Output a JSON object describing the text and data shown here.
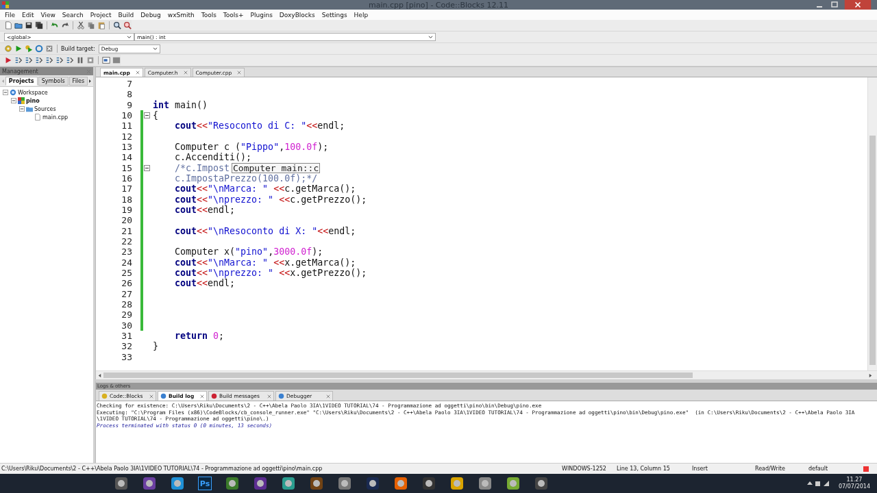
{
  "window": {
    "title": "main.cpp [pino] - Code::Blocks 12.11"
  },
  "menu": [
    "File",
    "Edit",
    "View",
    "Search",
    "Project",
    "Build",
    "Debug",
    "wxSmith",
    "Tools",
    "Tools+",
    "Plugins",
    "DoxyBlocks",
    "Settings",
    "Help"
  ],
  "scope_bar": {
    "scope": "<global>",
    "function": "main() : int"
  },
  "build_target": {
    "label": "Build target:",
    "value": "Debug"
  },
  "management": {
    "title": "Management",
    "tabs": [
      {
        "label": "Projects",
        "selected": true
      },
      {
        "label": "Symbols",
        "selected": false
      },
      {
        "label": "Files",
        "selected": false
      }
    ],
    "tree": [
      {
        "label": "Workspace",
        "kind": "workspace",
        "expanded": true,
        "children": [
          {
            "label": "pino",
            "kind": "project",
            "expanded": true,
            "children": [
              {
                "label": "Sources",
                "kind": "folder",
                "expanded": true,
                "children": [
                  {
                    "label": "main.cpp",
                    "kind": "file"
                  }
                ]
              }
            ]
          }
        ]
      }
    ]
  },
  "editor": {
    "tabs": [
      {
        "label": "main.cpp",
        "selected": true
      },
      {
        "label": "Computer.h",
        "selected": false
      },
      {
        "label": "Computer.cpp",
        "selected": false
      }
    ],
    "lines": [
      {
        "number": "7",
        "fold": false,
        "modified": false
      },
      {
        "number": "8",
        "fold": false,
        "modified": false
      },
      {
        "number": "9",
        "fold": false,
        "modified": false,
        "tokens": [
          {
            "kind": "keyword",
            "text": "int"
          },
          {
            "kind": "plain",
            "text": " main()"
          }
        ]
      },
      {
        "number": "10",
        "fold": true,
        "modified": true,
        "tokens": [
          {
            "kind": "plain",
            "text": "{"
          }
        ]
      },
      {
        "number": "11",
        "fold": false,
        "modified": true,
        "tokens": [
          {
            "kind": "keyword",
            "text": "    cout"
          },
          {
            "kind": "operator",
            "text": "<<"
          },
          {
            "kind": "string",
            "text": "\"Resoconto di C: \""
          },
          {
            "kind": "operator",
            "text": "<<"
          },
          {
            "kind": "plain",
            "text": "endl;"
          }
        ]
      },
      {
        "number": "12",
        "fold": false,
        "modified": true
      },
      {
        "number": "13",
        "fold": false,
        "modified": true,
        "tokens": [
          {
            "kind": "plain",
            "text": "    Computer c ("
          },
          {
            "kind": "string",
            "text": "\"Pippo\""
          },
          {
            "kind": "plain",
            "text": ","
          },
          {
            "kind": "number",
            "text": "100.0f"
          },
          {
            "kind": "plain",
            "text": ");"
          }
        ]
      },
      {
        "number": "14",
        "fold": false,
        "modified": true,
        "tokens": [
          {
            "kind": "plain",
            "text": "    c.Accenditi();"
          }
        ]
      },
      {
        "number": "15",
        "fold": true,
        "modified": true,
        "tokens": [
          {
            "kind": "comment",
            "text": "    /*c.Impost"
          }
        ]
      },
      {
        "number": "16",
        "fold": false,
        "modified": true,
        "tokens": [
          {
            "kind": "comment",
            "text": "    c.ImpostaPrezzo(100.0f);*/"
          }
        ]
      },
      {
        "number": "17",
        "fold": false,
        "modified": true,
        "tokens": [
          {
            "kind": "keyword",
            "text": "    cout"
          },
          {
            "kind": "operator",
            "text": "<<"
          },
          {
            "kind": "string",
            "text": "\"\\nMarca: \""
          },
          {
            "kind": "operator",
            "text": " <<"
          },
          {
            "kind": "plain",
            "text": "c.getMarca();"
          }
        ]
      },
      {
        "number": "18",
        "fold": false,
        "modified": true,
        "tokens": [
          {
            "kind": "keyword",
            "text": "    cout"
          },
          {
            "kind": "operator",
            "text": "<<"
          },
          {
            "kind": "string",
            "text": "\"\\nprezzo: \""
          },
          {
            "kind": "operator",
            "text": " <<"
          },
          {
            "kind": "plain",
            "text": "c.getPrezzo();"
          }
        ]
      },
      {
        "number": "19",
        "fold": false,
        "modified": true,
        "tokens": [
          {
            "kind": "keyword",
            "text": "    cout"
          },
          {
            "kind": "operator",
            "text": "<<"
          },
          {
            "kind": "plain",
            "text": "endl;"
          }
        ]
      },
      {
        "number": "20",
        "fold": false,
        "modified": true
      },
      {
        "number": "21",
        "fold": false,
        "modified": true,
        "tokens": [
          {
            "kind": "keyword",
            "text": "    cout"
          },
          {
            "kind": "operator",
            "text": "<<"
          },
          {
            "kind": "string",
            "text": "\"\\nResoconto di X: \""
          },
          {
            "kind": "operator",
            "text": "<<"
          },
          {
            "kind": "plain",
            "text": "endl;"
          }
        ]
      },
      {
        "number": "22",
        "fold": false,
        "modified": true
      },
      {
        "number": "23",
        "fold": false,
        "modified": true,
        "tokens": [
          {
            "kind": "plain",
            "text": "    Computer x("
          },
          {
            "kind": "string",
            "text": "\"pino\""
          },
          {
            "kind": "plain",
            "text": ","
          },
          {
            "kind": "number",
            "text": "3000.0f"
          },
          {
            "kind": "plain",
            "text": ");"
          }
        ]
      },
      {
        "number": "24",
        "fold": false,
        "modified": true,
        "tokens": [
          {
            "kind": "keyword",
            "text": "    cout"
          },
          {
            "kind": "operator",
            "text": "<<"
          },
          {
            "kind": "string",
            "text": "\"\\nMarca: \""
          },
          {
            "kind": "operator",
            "text": " <<"
          },
          {
            "kind": "plain",
            "text": "x.getMarca();"
          }
        ]
      },
      {
        "number": "25",
        "fold": false,
        "modified": true,
        "tokens": [
          {
            "kind": "keyword",
            "text": "    cout"
          },
          {
            "kind": "operator",
            "text": "<<"
          },
          {
            "kind": "string",
            "text": "\"\\nprezzo: \""
          },
          {
            "kind": "operator",
            "text": " <<"
          },
          {
            "kind": "plain",
            "text": "x.getPrezzo();"
          }
        ]
      },
      {
        "number": "26",
        "fold": false,
        "modified": true,
        "tokens": [
          {
            "kind": "keyword",
            "text": "    cout"
          },
          {
            "kind": "operator",
            "text": "<<"
          },
          {
            "kind": "plain",
            "text": "endl;"
          }
        ]
      },
      {
        "number": "27",
        "fold": false,
        "modified": true
      },
      {
        "number": "28",
        "fold": false,
        "modified": true
      },
      {
        "number": "29",
        "fold": false,
        "modified": true
      },
      {
        "number": "30",
        "fold": false,
        "modified": true
      },
      {
        "number": "31",
        "fold": false,
        "modified": false,
        "tokens": [
          {
            "kind": "keyword",
            "text": "    return"
          },
          {
            "kind": "number",
            "text": " 0"
          },
          {
            "kind": "plain",
            "text": ";"
          }
        ]
      },
      {
        "number": "32",
        "fold": false,
        "modified": false,
        "tokens": [
          {
            "kind": "plain",
            "text": "}"
          }
        ]
      },
      {
        "number": "33",
        "fold": false,
        "modified": false
      }
    ],
    "tooltip": "Computer main::c"
  },
  "logs": {
    "title": "Logs & others",
    "tabs": [
      {
        "label": "Code::Blocks",
        "selected": false
      },
      {
        "label": "Build log",
        "selected": true
      },
      {
        "label": "Build messages",
        "selected": false
      },
      {
        "label": "Debugger",
        "selected": false
      }
    ],
    "lines": [
      {
        "kind": "plain",
        "text": "Checking for existence: C:\\Users\\Riku\\Documents\\2 - C++\\Abela Paolo 3IA\\1VIDEO TUTORIAL\\74 - Programmazione ad oggetti\\pino\\bin\\Debug\\pino.exe"
      },
      {
        "kind": "plain",
        "text": "Executing: \"C:\\Program Files (x86)\\CodeBlocks/cb_console_runner.exe\" \"C:\\Users\\Riku\\Documents\\2 - C++\\Abela Paolo 3IA\\1VIDEO TUTORIAL\\74 - Programmazione ad oggetti\\pino\\bin\\Debug\\pino.exe\"  (in C:\\Users\\Riku\\Documents\\2 - C++\\Abela Paolo 3IA"
      },
      {
        "kind": "plain",
        "text": "\\1VIDEO TUTORIAL\\74 - Programmazione ad oggetti\\pino\\.)"
      },
      {
        "kind": "status",
        "text": "Process terminated with status 0 (0 minutes, 13 seconds)"
      }
    ]
  },
  "status_bar": {
    "path": "C:\\Users\\Riku\\Documents\\2 - C++\\Abela Paolo 3IA\\1VIDEO TUTORIAL\\74 - Programmazione ad oggetti\\pino\\main.cpp",
    "encoding": "WINDOWS-1252",
    "position": "Line 13, Column 15",
    "mode": "Insert",
    "access": "Read/Write",
    "theme": "default"
  },
  "taskbar": {
    "app_badge_text": "Ps",
    "time": "11.27",
    "date": "07/07/2014"
  }
}
